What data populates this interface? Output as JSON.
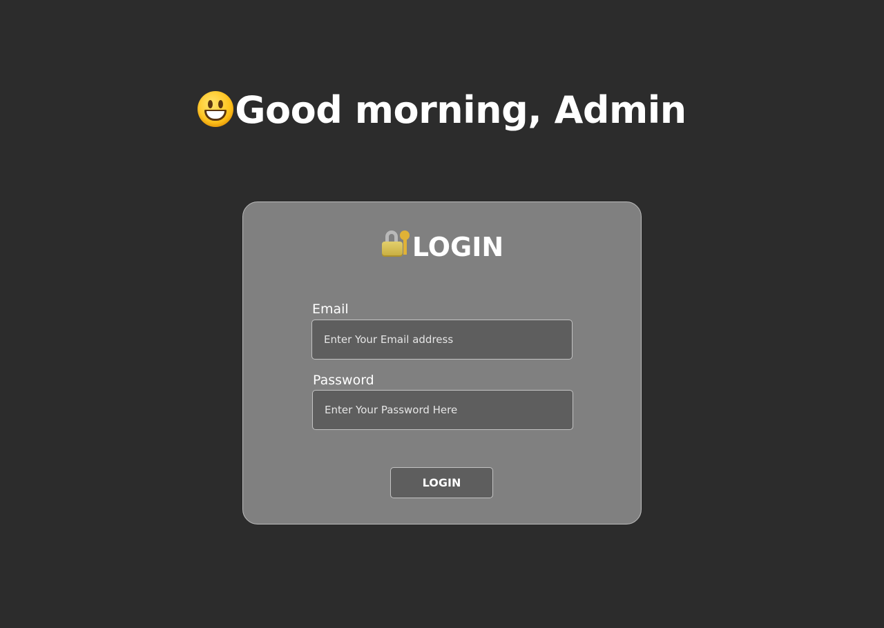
{
  "header": {
    "greeting": "Good morning, Admin",
    "greeting_icon": "smiley-icon"
  },
  "login_card": {
    "title": "LOGIN",
    "title_icon": "lock-with-key-icon",
    "email": {
      "label": "Email",
      "value": "",
      "placeholder": "Enter Your Email address"
    },
    "password": {
      "label": "Password",
      "value": "",
      "placeholder": "Enter Your Password Here"
    },
    "submit_label": "LOGIN"
  },
  "colors": {
    "background": "#2c2c2c",
    "card": "#808080",
    "input": "#5e5e5e",
    "border": "#c4c4c4",
    "text": "#ffffff"
  }
}
